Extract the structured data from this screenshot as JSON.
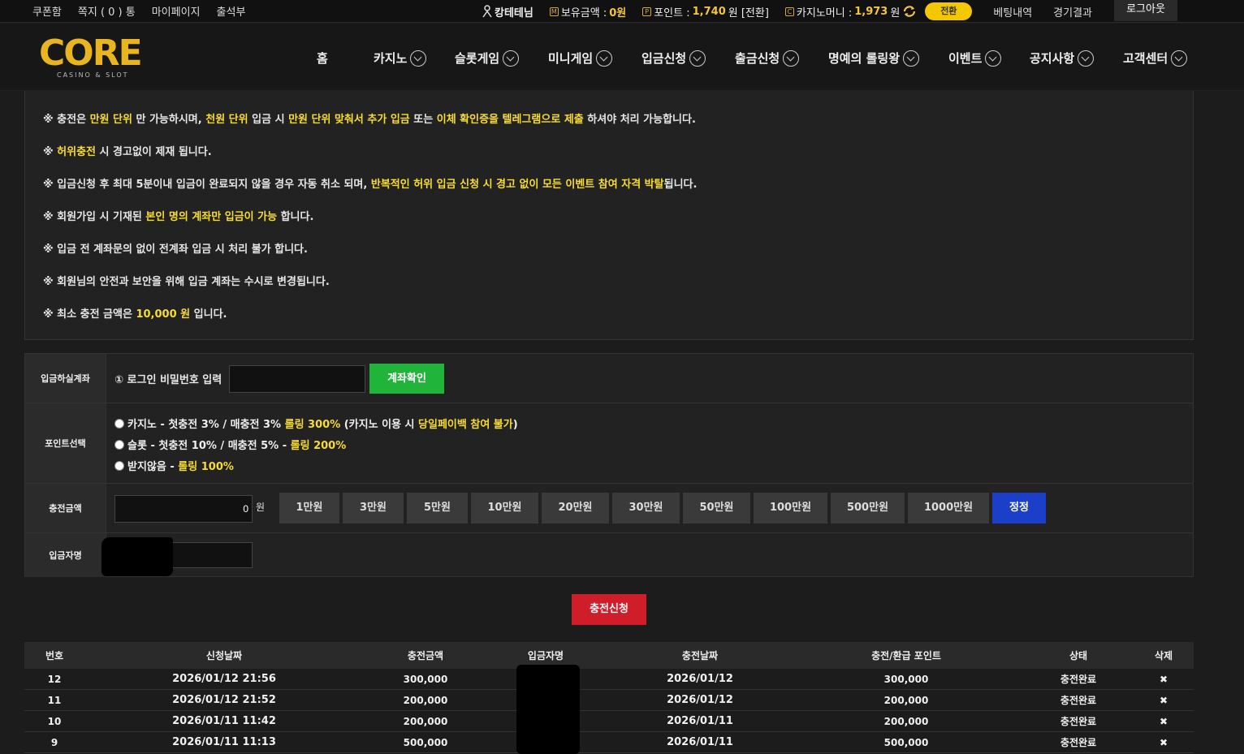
{
  "topbar": {
    "links": [
      "쿠폰함",
      "쪽지 ( 0 ) 통",
      "마이페이지",
      "출석부"
    ],
    "user": "캉테테님",
    "balance_label": "보유금액 :",
    "balance_value": "0원",
    "points_label": "포인트 :",
    "points_value": "1,740",
    "points_suffix": "원 [전환]",
    "casino_label": "카지노머니 :",
    "casino_value": "1,973",
    "casino_suffix": "원",
    "exchange": "전환",
    "bet_history": "베팅내역",
    "results": "경기결과",
    "logout": "로그아웃"
  },
  "logo": {
    "brand": "CORE",
    "sub": "CASINO & SLOT"
  },
  "nav": [
    "홈",
    "카지노",
    "슬롯게임",
    "미니게임",
    "입금신청",
    "출금신청",
    "명예의 롤링왕",
    "이벤트",
    "공지사항",
    "고객센터"
  ],
  "notices": [
    [
      {
        "t": "※ 충전은 "
      },
      {
        "t": "만원 단위",
        "y": true
      },
      {
        "t": " 만 가능하시며, "
      },
      {
        "t": "천원 단위",
        "y": true
      },
      {
        "t": " 입금 시 "
      },
      {
        "t": "만원 단위 맞춰서 추가 입금",
        "y": true
      },
      {
        "t": " 또는 "
      },
      {
        "t": "이체 확인증을 텔레그램으로 제출",
        "y": true
      },
      {
        "t": " 하셔야 처리 가능합니다."
      }
    ],
    [
      {
        "t": "※ "
      },
      {
        "t": "허위충전",
        "y": true
      },
      {
        "t": " 시 경고없이 제재 됩니다."
      }
    ],
    [
      {
        "t": "※ 입금신청 후 최대 5분이내 입금이 완료되지 않을 경우 자동 취소 되며, "
      },
      {
        "t": "반복적인 허위 입금 신청 시 경고 없이 모든 이벤트 참여 자격 박탈",
        "y": true
      },
      {
        "t": "됩니다."
      }
    ],
    [
      {
        "t": "※ 회원가입 시 기재된 "
      },
      {
        "t": "본인 명의 계좌만 입금이 가능",
        "y": true
      },
      {
        "t": " 합니다."
      }
    ],
    [
      {
        "t": "※ 입금 전 계좌문의 없이 전계좌 입금 시 처리 불가 합니다."
      }
    ],
    [
      {
        "t": "※ 회원님의 안전과 보안을 위해 입금 계좌는 수시로 변경됩니다."
      }
    ],
    [
      {
        "t": "※ 최소 충전 금액은 "
      },
      {
        "t": "10,000 원",
        "y": true
      },
      {
        "t": " 입니다."
      }
    ]
  ],
  "form": {
    "account_label": "입금하실계좌",
    "password_prompt": "① 로그인 비밀번호 입력",
    "password_value": "",
    "check_button": "계좌확인",
    "point_label": "포인트선택",
    "point_options": [
      [
        {
          "t": "카지노 - 첫충전 3% / 매충전 3% "
        },
        {
          "t": "롤링 300%",
          "y": true
        },
        {
          "t": " (카지노 이용 시 "
        },
        {
          "t": "당일페이백 참여 불가",
          "y": true
        },
        {
          "t": ")"
        }
      ],
      [
        {
          "t": "슬롯 - 첫충전 10% / 매충전 5% - "
        },
        {
          "t": "롤링 200%",
          "y": true
        }
      ],
      [
        {
          "t": "받지않음 - "
        },
        {
          "t": "롤링 100%",
          "y": true
        }
      ]
    ],
    "amount_label": "충전금액",
    "amount_value": "0",
    "amount_unit": "원",
    "amount_buttons": [
      "1만원",
      "3만원",
      "5만원",
      "10만원",
      "20만원",
      "30만원",
      "50만원",
      "100만원",
      "500만원",
      "1000만원"
    ],
    "correct_button": "정정",
    "depositor_label": "입금자명",
    "depositor_value": ""
  },
  "submit": "충전신청",
  "table": {
    "headers": [
      "번호",
      "신청날짜",
      "충전금액",
      "입금자명",
      "충전날짜",
      "충전/환급 포인트",
      "상태",
      "삭제"
    ],
    "rows": [
      [
        "12",
        "2026/01/12 21:56",
        "300,000",
        "",
        "2026/01/12",
        "300,000",
        "충전완료",
        "✖"
      ],
      [
        "11",
        "2026/01/12 21:52",
        "200,000",
        "",
        "2026/01/12",
        "200,000",
        "충전완료",
        "✖"
      ],
      [
        "10",
        "2026/01/11 11:42",
        "200,000",
        "",
        "2026/01/11",
        "200,000",
        "충전완료",
        "✖"
      ],
      [
        "9",
        "2026/01/11 11:13",
        "500,000",
        "",
        "2026/01/11",
        "500,000",
        "충전완료",
        "✖"
      ]
    ]
  },
  "colors": {
    "highlight": "#f7dc34",
    "green": "#21b43a",
    "red": "#d01d2a",
    "blue": "#1c3fc9",
    "exchange": "#f4c800"
  }
}
